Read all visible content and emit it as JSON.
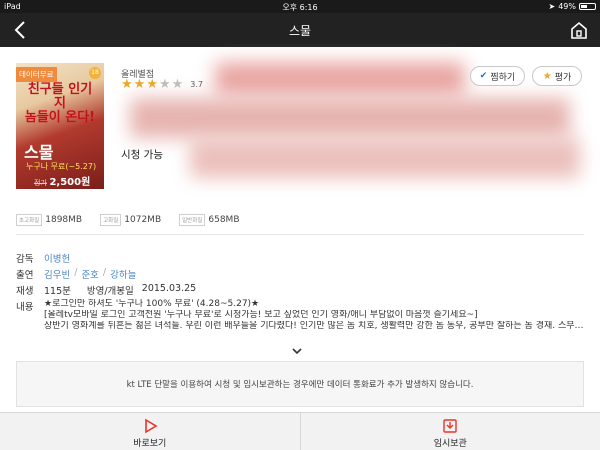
{
  "status_bar": {
    "device": "iPad",
    "time": "오후 6:16",
    "battery": "49%"
  },
  "nav": {
    "title": "스물"
  },
  "poster": {
    "free_badge": "데이터무료",
    "age_badge": "18",
    "title_lines": [
      "친구들 인기지",
      "놈들이 온다!"
    ],
    "name": "스물",
    "free_period": "누구나 무료(~5.27)",
    "original_price": "정가",
    "price": "2,500원"
  },
  "info": {
    "category": "올레별점",
    "stars_on": 3,
    "stars_total": 5,
    "rating": "3.7",
    "watch_status": "시청 가능"
  },
  "actions": {
    "zzim": "찜하기",
    "rate": "평가"
  },
  "sizes": [
    {
      "tag": "초고화질",
      "value": "1898MB"
    },
    {
      "tag": "고화질",
      "value": "1072MB"
    },
    {
      "tag": "일반화질",
      "value": "658MB"
    }
  ],
  "details": {
    "director_label": "감독",
    "director": "이병헌",
    "cast_label": "출연",
    "cast": [
      "김우빈",
      "준호",
      "강하늘"
    ],
    "play_label": "재생",
    "runtime": "115분",
    "release_label": "방영/개봉일",
    "release_date": "2015.03.25",
    "content_label": "내용",
    "content_lines": [
      "★로그인만 하셔도 '누구나 100% 무료' (4.28~5.27)★",
      "[올레tv모바일 로그인 고객전원 '누구나 무료'로 시청가능! 보고 싶었던 인기 영화/애니 부담없이 마음껏 즐기세요~]",
      "상반기 영화계를 뒤흔든 젊은 녀석들. 우린 이런 배우들을 기다렸다! 인기만 많은 놈 치호, 생활력만 강한 놈 동우, 공부만 잘하는 놈 경재. 스무 살 동갑…"
    ]
  },
  "notice": "kt LTE 단말을 이용하여 시청 및 임시보관하는 경우에만 데이터 통화료가 추가 발생하지 않습니다.",
  "toolbar": {
    "watch": "바로보기",
    "save": "임시보관"
  },
  "colors": {
    "accent_red": "#e8352b",
    "link_blue": "#4a86c7",
    "star": "#e9a825",
    "badge_orange": "#f08a3c"
  }
}
